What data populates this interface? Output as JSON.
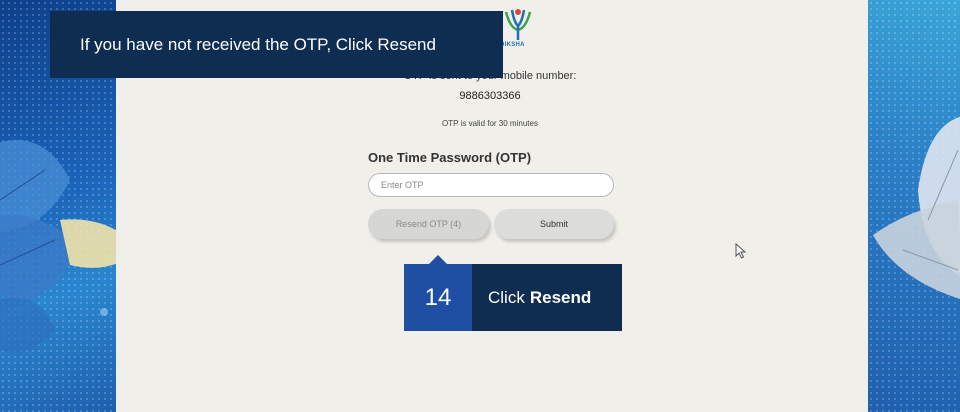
{
  "banner": {
    "text": "If you have not received the OTP, Click Resend"
  },
  "logo": {
    "name": "diksha-logo-icon",
    "text": "DIKSHA"
  },
  "otp": {
    "sent_text": "OTP is sent to your mobile number:",
    "phone": "9886303366",
    "valid_text": "OTP is valid for 30 minutes",
    "label": "One Time Password (OTP)",
    "placeholder": "Enter OTP"
  },
  "buttons": {
    "resend_label": "Resend OTP (4)",
    "submit_label": "Submit"
  },
  "callout": {
    "step_number": "14",
    "prefix": "Click",
    "action": "Resend"
  },
  "colors": {
    "banner_bg": "#0f2d51",
    "callout_num_bg": "#1f4fa3",
    "panel_bg": "#f0efe9",
    "accent": "#1f6fb8"
  }
}
